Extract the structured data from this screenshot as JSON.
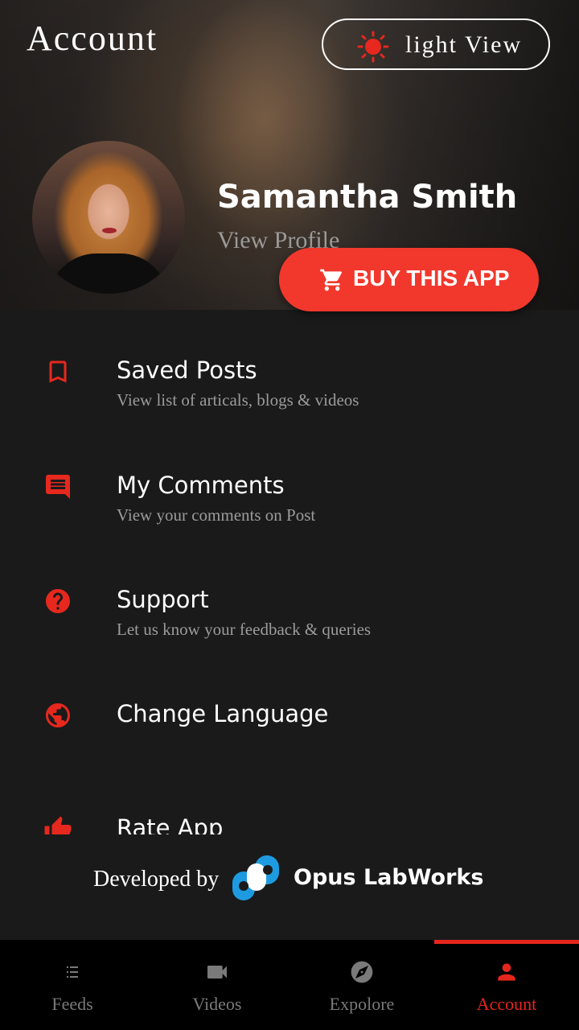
{
  "header": {
    "title": "Account",
    "theme_toggle_label": "light View"
  },
  "profile": {
    "name": "Samantha Smith",
    "view_profile": "View Profile",
    "buy_button": "BUY THIS APP"
  },
  "menu": {
    "items": [
      {
        "icon": "bookmark-icon",
        "title": "Saved Posts",
        "subtitle": "View list of articals, blogs & videos"
      },
      {
        "icon": "comment-icon",
        "title": "My Comments",
        "subtitle": "View your comments on Post"
      },
      {
        "icon": "help-icon",
        "title": "Support",
        "subtitle": "Let us know your feedback & queries"
      },
      {
        "icon": "globe-icon",
        "title": "Change Language",
        "subtitle": ""
      },
      {
        "icon": "thumbs-up-icon",
        "title": "Rate App",
        "subtitle": ""
      }
    ]
  },
  "footer": {
    "developed_by": "Developed by",
    "company": "Opus LabWorks"
  },
  "bottom_nav": {
    "items": [
      {
        "label": "Feeds",
        "icon": "list-icon"
      },
      {
        "label": "Videos",
        "icon": "video-camera-icon"
      },
      {
        "label": "Expolore",
        "icon": "compass-icon"
      },
      {
        "label": "Account",
        "icon": "person-icon"
      }
    ],
    "active": "Account"
  },
  "colors": {
    "accent": "#f2382d",
    "active_nav": "#e5261c",
    "background": "#1a1a1a"
  }
}
